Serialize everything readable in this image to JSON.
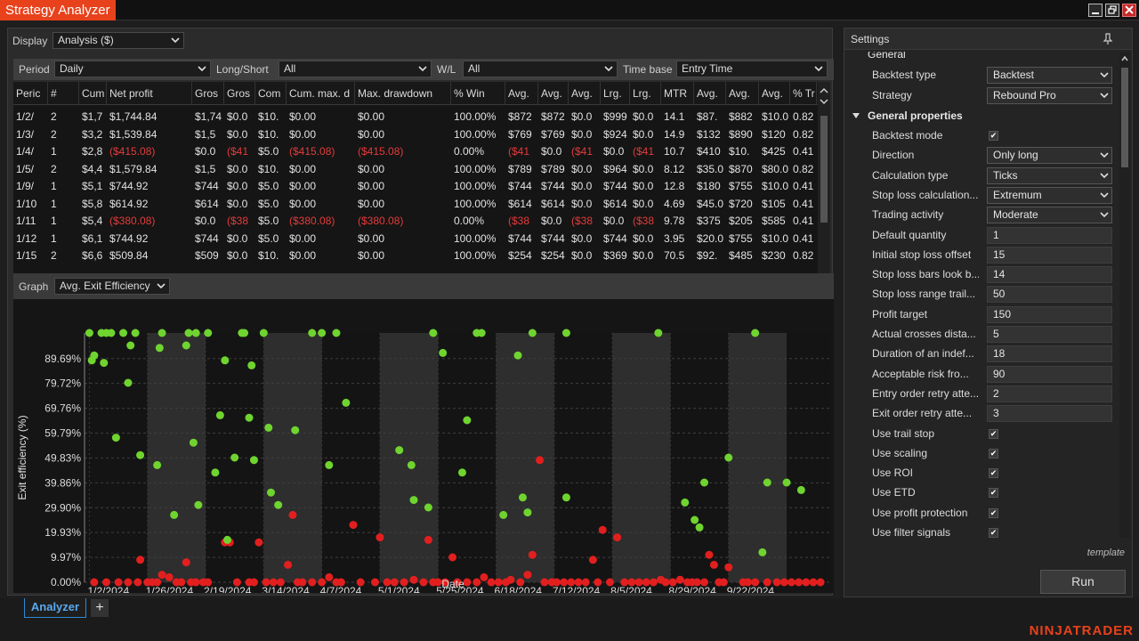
{
  "window": {
    "title": "Strategy Analyzer"
  },
  "display": {
    "label": "Display",
    "value": "Analysis ($)"
  },
  "filters": {
    "period_label": "Period",
    "period_value": "Daily",
    "longshort_label": "Long/Short",
    "longshort_value": "All",
    "wl_label": "W/L",
    "wl_value": "All",
    "timebase_label": "Time base",
    "timebase_value": "Entry Time"
  },
  "table": {
    "headers": [
      "Peric",
      "#",
      "Cum",
      "Net profit",
      "Gros",
      "Gros",
      "Com",
      "Cum. max. d",
      "Max. drawdown",
      "% Win",
      "Avg.",
      "Avg.",
      "Avg.",
      "Lrg.",
      "Lrg.",
      "MTR",
      "Avg.",
      "Avg.",
      "Avg.",
      "% Tr"
    ],
    "rows": [
      [
        "1/2/",
        "2",
        "$1,7",
        "$1,744.84",
        "$1,74",
        "$0.0",
        "$10.",
        "$0.00",
        "$0.00",
        "100.00%",
        "$872",
        "$872",
        "$0.0",
        "$999",
        "$0.0",
        "14.1",
        "$87.",
        "$882",
        "$10.0",
        "0.82"
      ],
      [
        "1/3/",
        "2",
        "$3,2",
        "$1,539.84",
        "$1,5",
        "$0.0",
        "$10.",
        "$0.00",
        "$0.00",
        "100.00%",
        "$769",
        "$769",
        "$0.0",
        "$924",
        "$0.0",
        "14.9",
        "$132",
        "$890",
        "$120",
        "0.82"
      ],
      [
        "1/4/",
        "1",
        "$2,8",
        "($415.08)",
        "$0.0",
        "($41",
        "$5.0",
        "($415.08)",
        "($415.08)",
        "0.00%",
        "($41",
        "$0.0",
        "($41",
        "$0.0",
        "($41",
        "10.7",
        "$410",
        "$10.",
        "$425",
        "0.41"
      ],
      [
        "1/5/",
        "2",
        "$4,4",
        "$1,579.84",
        "$1,5",
        "$0.0",
        "$10.",
        "$0.00",
        "$0.00",
        "100.00%",
        "$789",
        "$789",
        "$0.0",
        "$964",
        "$0.0",
        "8.12",
        "$35.0",
        "$870",
        "$80.0",
        "0.82"
      ],
      [
        "1/9/",
        "1",
        "$5,1",
        "$744.92",
        "$744",
        "$0.0",
        "$5.0",
        "$0.00",
        "$0.00",
        "100.00%",
        "$744",
        "$744",
        "$0.0",
        "$744",
        "$0.0",
        "12.8",
        "$180",
        "$755",
        "$10.0",
        "0.41"
      ],
      [
        "1/10",
        "1",
        "$5,8",
        "$614.92",
        "$614",
        "$0.0",
        "$5.0",
        "$0.00",
        "$0.00",
        "100.00%",
        "$614",
        "$614",
        "$0.0",
        "$614",
        "$0.0",
        "4.69",
        "$45.0",
        "$720",
        "$105",
        "0.41"
      ],
      [
        "1/11",
        "1",
        "$5,4",
        "($380.08)",
        "$0.0",
        "($38",
        "$5.0",
        "($380.08)",
        "($380.08)",
        "0.00%",
        "($38",
        "$0.0",
        "($38",
        "$0.0",
        "($38",
        "9.78",
        "$375",
        "$205",
        "$585",
        "0.41"
      ],
      [
        "1/12",
        "1",
        "$6,1",
        "$744.92",
        "$744",
        "$0.0",
        "$5.0",
        "$0.00",
        "$0.00",
        "100.00%",
        "$744",
        "$744",
        "$0.0",
        "$744",
        "$0.0",
        "3.95",
        "$20.0",
        "$755",
        "$10.0",
        "0.41"
      ],
      [
        "1/15",
        "2",
        "$6,6",
        "$509.84",
        "$509",
        "$0.0",
        "$10.",
        "$0.00",
        "$0.00",
        "100.00%",
        "$254",
        "$254",
        "$0.0",
        "$369",
        "$0.0",
        "70.5",
        "$92.",
        "$485",
        "$230",
        "0.82"
      ]
    ],
    "negative_rows": [
      2,
      6
    ]
  },
  "graph": {
    "label": "Graph",
    "value": "Avg. Exit Efficiency"
  },
  "chart_data": {
    "type": "scatter",
    "xlabel": "Date",
    "ylabel": "Exit efficiency (%)",
    "ylim": [
      0,
      100
    ],
    "y_ticks": [
      "0.00%",
      "9.97%",
      "19.93%",
      "29.90%",
      "39.86%",
      "49.83%",
      "59.79%",
      "69.76%",
      "79.72%",
      "89.69%"
    ],
    "x_ticks": [
      "1/2/2024",
      "1/26/2024",
      "2/19/2024",
      "3/14/2024",
      "4/7/2024",
      "5/1/2024",
      "5/25/2024",
      "6/18/2024",
      "7/12/2024",
      "8/5/2024",
      "8/29/2024",
      "9/22/2024"
    ],
    "x_days": [
      0,
      24,
      48,
      72,
      96,
      120,
      144,
      168,
      192,
      216,
      240,
      264
    ],
    "x_range": [
      -2,
      306
    ],
    "shaded_bands": [
      [
        24,
        48
      ],
      [
        72,
        96
      ],
      [
        120,
        144
      ],
      [
        168,
        192
      ],
      [
        216,
        240
      ],
      [
        264,
        288
      ]
    ],
    "colors": {
      "win": "#6fd42f",
      "loss": "#e21f1f"
    },
    "win_points": [
      [
        0,
        100
      ],
      [
        1,
        89
      ],
      [
        2,
        91
      ],
      [
        5,
        100
      ],
      [
        6,
        88
      ],
      [
        7,
        100
      ],
      [
        9,
        100
      ],
      [
        11,
        58
      ],
      [
        14,
        100
      ],
      [
        16,
        80
      ],
      [
        17,
        95
      ],
      [
        19,
        100
      ],
      [
        21,
        51
      ],
      [
        28,
        47
      ],
      [
        29,
        94
      ],
      [
        30,
        100
      ],
      [
        35,
        27
      ],
      [
        40,
        95
      ],
      [
        41,
        100
      ],
      [
        43,
        56
      ],
      [
        44,
        100
      ],
      [
        45,
        31
      ],
      [
        49,
        100
      ],
      [
        52,
        44
      ],
      [
        54,
        67
      ],
      [
        56,
        89
      ],
      [
        57,
        17
      ],
      [
        60,
        50
      ],
      [
        63,
        100
      ],
      [
        64,
        100
      ],
      [
        66,
        66
      ],
      [
        67,
        87
      ],
      [
        68,
        49
      ],
      [
        72,
        100
      ],
      [
        74,
        62
      ],
      [
        75,
        36
      ],
      [
        78,
        31
      ],
      [
        85,
        61
      ],
      [
        92,
        100
      ],
      [
        96,
        100
      ],
      [
        99,
        47
      ],
      [
        102,
        100
      ],
      [
        106,
        72
      ],
      [
        128,
        53
      ],
      [
        133,
        47
      ],
      [
        134,
        33
      ],
      [
        140,
        30
      ],
      [
        142,
        100
      ],
      [
        146,
        92
      ],
      [
        154,
        44
      ],
      [
        156,
        65
      ],
      [
        160,
        100
      ],
      [
        162,
        100
      ],
      [
        171,
        27
      ],
      [
        177,
        91
      ],
      [
        179,
        34
      ],
      [
        181,
        28
      ],
      [
        183,
        100
      ],
      [
        197,
        100
      ],
      [
        197,
        34
      ],
      [
        235,
        100
      ],
      [
        246,
        32
      ],
      [
        250,
        25
      ],
      [
        252,
        22
      ],
      [
        254,
        40
      ],
      [
        264,
        50
      ],
      [
        275,
        100
      ],
      [
        278,
        12
      ],
      [
        280,
        40
      ],
      [
        288,
        40
      ],
      [
        294,
        37
      ]
    ],
    "loss_points": [
      [
        2,
        0
      ],
      [
        7,
        0
      ],
      [
        12,
        0
      ],
      [
        16,
        0
      ],
      [
        20,
        0
      ],
      [
        21,
        9
      ],
      [
        24,
        0
      ],
      [
        26,
        0
      ],
      [
        28,
        0
      ],
      [
        30,
        3
      ],
      [
        33,
        2
      ],
      [
        36,
        0
      ],
      [
        38,
        0
      ],
      [
        40,
        8
      ],
      [
        42,
        0
      ],
      [
        44,
        0
      ],
      [
        47,
        0
      ],
      [
        49,
        0
      ],
      [
        56,
        16
      ],
      [
        58,
        16
      ],
      [
        61,
        0
      ],
      [
        66,
        0
      ],
      [
        68,
        0
      ],
      [
        70,
        16
      ],
      [
        73,
        0
      ],
      [
        76,
        0
      ],
      [
        79,
        0
      ],
      [
        82,
        7
      ],
      [
        84,
        27
      ],
      [
        86,
        0
      ],
      [
        88,
        0
      ],
      [
        92,
        0
      ],
      [
        96,
        0
      ],
      [
        99,
        2
      ],
      [
        102,
        0
      ],
      [
        104,
        0
      ],
      [
        109,
        23
      ],
      [
        112,
        0
      ],
      [
        118,
        0
      ],
      [
        120,
        18
      ],
      [
        123,
        0
      ],
      [
        126,
        0
      ],
      [
        130,
        0
      ],
      [
        134,
        1
      ],
      [
        138,
        0
      ],
      [
        140,
        17
      ],
      [
        142,
        0
      ],
      [
        144,
        0
      ],
      [
        147,
        0
      ],
      [
        150,
        10
      ],
      [
        152,
        0
      ],
      [
        156,
        0
      ],
      [
        160,
        0
      ],
      [
        163,
        2
      ],
      [
        166,
        0
      ],
      [
        169,
        0
      ],
      [
        172,
        0
      ],
      [
        174,
        1
      ],
      [
        178,
        0
      ],
      [
        181,
        3
      ],
      [
        183,
        11
      ],
      [
        186,
        49
      ],
      [
        188,
        0
      ],
      [
        191,
        0
      ],
      [
        193,
        0
      ],
      [
        196,
        0
      ],
      [
        199,
        0
      ],
      [
        202,
        0
      ],
      [
        205,
        0
      ],
      [
        208,
        9
      ],
      [
        210,
        0
      ],
      [
        212,
        21
      ],
      [
        215,
        0
      ],
      [
        218,
        18
      ],
      [
        221,
        0
      ],
      [
        224,
        0
      ],
      [
        227,
        0
      ],
      [
        230,
        0
      ],
      [
        233,
        0
      ],
      [
        236,
        1
      ],
      [
        238,
        0
      ],
      [
        241,
        0
      ],
      [
        244,
        1
      ],
      [
        247,
        0
      ],
      [
        249,
        0
      ],
      [
        251,
        0
      ],
      [
        254,
        0
      ],
      [
        256,
        11
      ],
      [
        258,
        7
      ],
      [
        260,
        0
      ],
      [
        262,
        0
      ],
      [
        264,
        6
      ],
      [
        270,
        0
      ],
      [
        272,
        0
      ],
      [
        275,
        0
      ],
      [
        280,
        0
      ],
      [
        284,
        0
      ],
      [
        287,
        0
      ],
      [
        290,
        0
      ],
      [
        293,
        0
      ],
      [
        296,
        0
      ],
      [
        299,
        0
      ],
      [
        302,
        0
      ]
    ]
  },
  "settings": {
    "title": "Settings",
    "category_general": "General",
    "category_general_props": "General properties",
    "backtest_type": {
      "label": "Backtest type",
      "value": "Backtest"
    },
    "strategy": {
      "label": "Strategy",
      "value": "Rebound Pro"
    },
    "props": [
      {
        "label": "Backtest mode",
        "kind": "check"
      },
      {
        "label": "Direction",
        "kind": "dd",
        "value": "Only long"
      },
      {
        "label": "Calculation type",
        "kind": "dd",
        "value": "Ticks"
      },
      {
        "label": "Stop loss calculation...",
        "kind": "dd",
        "value": "Extremum"
      },
      {
        "label": "Trading activity",
        "kind": "dd",
        "value": "Moderate"
      },
      {
        "label": "Default quantity",
        "kind": "val",
        "value": "1"
      },
      {
        "label": "Initial stop loss offset",
        "kind": "val",
        "value": "15"
      },
      {
        "label": "Stop loss bars look b...",
        "kind": "val",
        "value": "14"
      },
      {
        "label": "Stop loss range trail...",
        "kind": "val",
        "value": "50"
      },
      {
        "label": "Profit target",
        "kind": "val",
        "value": "150"
      },
      {
        "label": "Actual crosses dista...",
        "kind": "val",
        "value": "5"
      },
      {
        "label": "Duration of an indef...",
        "kind": "val",
        "value": "18"
      },
      {
        "label": "Acceptable risk fro...",
        "kind": "val",
        "value": "90"
      },
      {
        "label": "Entry order retry atte...",
        "kind": "val",
        "value": "2"
      },
      {
        "label": "Exit order retry atte...",
        "kind": "val",
        "value": "3"
      },
      {
        "label": "Use trail stop",
        "kind": "check"
      },
      {
        "label": "Use scaling",
        "kind": "check"
      },
      {
        "label": "Use ROI",
        "kind": "check"
      },
      {
        "label": "Use ETD",
        "kind": "check"
      },
      {
        "label": "Use profit protection",
        "kind": "check"
      },
      {
        "label": "Use filter signals",
        "kind": "check"
      }
    ],
    "template_label": "template",
    "run_label": "Run"
  },
  "tabs": {
    "active": "Analyzer",
    "add": "+"
  },
  "brand": "NINJATRADER"
}
